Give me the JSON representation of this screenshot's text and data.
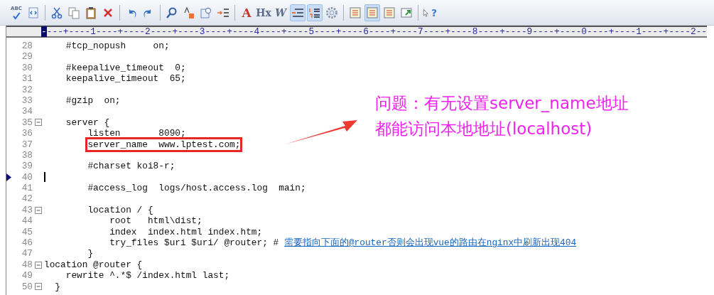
{
  "toolbar": [
    {
      "kind": "spellcheck",
      "glyph": "ABC",
      "pressed": false
    },
    {
      "kind": "html",
      "pressed": false
    },
    {
      "kind": "sep"
    },
    {
      "kind": "cut",
      "pressed": false
    },
    {
      "kind": "copy",
      "pressed": false
    },
    {
      "kind": "paste",
      "pressed": false
    },
    {
      "kind": "delete",
      "pressed": false
    },
    {
      "kind": "sep"
    },
    {
      "kind": "undo",
      "pressed": false
    },
    {
      "kind": "redo",
      "pressed": false
    },
    {
      "kind": "sep"
    },
    {
      "kind": "find",
      "pressed": false
    },
    {
      "kind": "replace",
      "pressed": false
    },
    {
      "kind": "goto",
      "pressed": false
    },
    {
      "kind": "numbering",
      "pressed": false
    },
    {
      "kind": "sep"
    },
    {
      "kind": "font",
      "glyph": "A",
      "pressed": false
    },
    {
      "kind": "text",
      "glyph": "Hx",
      "pressed": false
    },
    {
      "kind": "italic",
      "glyph": "W",
      "pressed": false
    },
    {
      "kind": "wrap",
      "pressed": true
    },
    {
      "kind": "linenumbers",
      "pressed": true
    },
    {
      "kind": "settings",
      "pressed": false
    },
    {
      "kind": "sep"
    },
    {
      "kind": "panel",
      "pressed": false
    },
    {
      "kind": "panel",
      "pressed": true
    },
    {
      "kind": "panel",
      "pressed": false
    },
    {
      "kind": "window",
      "pressed": false
    },
    {
      "kind": "sep"
    },
    {
      "kind": "help",
      "glyph": "?",
      "pressed": false
    }
  ],
  "ruler": {
    "marker": "-",
    "scale": "---+----1----+----2----+----3----+----4----+----5----+----6----+----7----+----8----+----9----+----0----+----1----+----2--"
  },
  "lines": [
    {
      "number": "28",
      "text": "    #tcp_nopush     on;",
      "fold": false,
      "bookmark": false,
      "boxed": false
    },
    {
      "number": "29",
      "fold": false,
      "bookmark": false,
      "boxed": false
    },
    {
      "number": "30",
      "text": "    #keepalive_timeout  0;",
      "fold": false,
      "bookmark": false,
      "boxed": false
    },
    {
      "number": "31",
      "text": "    keepalive_timeout  65;",
      "fold": false,
      "bookmark": false,
      "boxed": false
    },
    {
      "number": "32",
      "fold": false,
      "bookmark": false,
      "boxed": false
    },
    {
      "number": "33",
      "text": "    #gzip  on;",
      "fold": false,
      "bookmark": false,
      "boxed": false
    },
    {
      "number": "34",
      "fold": false,
      "bookmark": false,
      "boxed": false
    },
    {
      "number": "35",
      "text": "    server {",
      "fold": true,
      "bookmark": false,
      "boxed": false
    },
    {
      "number": "36",
      "text": "        listen       8090;",
      "fold": false,
      "bookmark": false,
      "boxed": false
    },
    {
      "number": "37",
      "text": "        server_name  www.lptest.com;",
      "fold": false,
      "bookmark": false,
      "boxed": true
    },
    {
      "number": "38",
      "fold": false,
      "bookmark": false,
      "boxed": false
    },
    {
      "number": "39",
      "text": "        #charset koi8-r;",
      "fold": false,
      "bookmark": false,
      "boxed": false
    },
    {
      "number": "40",
      "fold": false,
      "bookmark": true,
      "boxed": false,
      "cursor": true
    },
    {
      "number": "41",
      "text": "        #access_log  logs/host.access.log  main;",
      "fold": false,
      "bookmark": false,
      "boxed": false
    },
    {
      "number": "42",
      "fold": false,
      "bookmark": false,
      "boxed": false
    },
    {
      "number": "43",
      "text": "        location / {",
      "fold": true,
      "bookmark": false,
      "boxed": false
    },
    {
      "number": "44",
      "text": "            root   html\\dist;",
      "fold": false,
      "bookmark": false,
      "boxed": false
    },
    {
      "number": "45",
      "text": "            index  index.html index.htm;",
      "fold": false,
      "bookmark": false,
      "boxed": false
    },
    {
      "number": "46",
      "text": "            try_files $uri $uri/ @router; # ",
      "comment_link": "需要指向下面的@router否则会出现vue的路由在nginx中刷新出现404",
      "fold": false,
      "bookmark": false,
      "boxed": false
    },
    {
      "number": "47",
      "text": "        }",
      "fold": false,
      "bookmark": false,
      "boxed": false
    },
    {
      "number": "48",
      "text": "location @router {",
      "fold": true,
      "bookmark": false,
      "boxed": false
    },
    {
      "number": "49",
      "text": "    rewrite ^.*$ /index.html last;",
      "fold": false,
      "bookmark": false,
      "boxed": false
    },
    {
      "number": "50",
      "text": "  }",
      "fold": true,
      "bookmark": false,
      "boxed": false
    }
  ],
  "annotation": {
    "lines": [
      "问题：有无设置server_name地址",
      "都能访问本地地址(localhost)"
    ]
  }
}
